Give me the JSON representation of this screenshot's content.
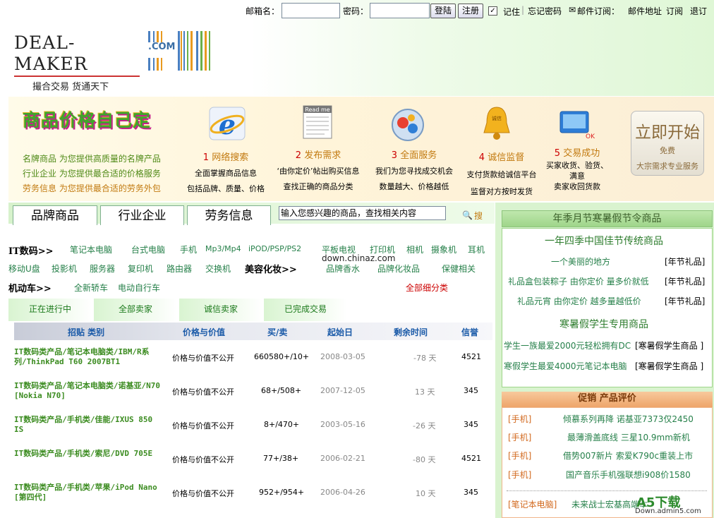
{
  "login": {
    "email_label": "邮箱名：",
    "password_label": "密码：",
    "login_btn": "登陆",
    "register_btn": "注册",
    "remember": "记住",
    "forgot": "忘记密码",
    "subscribe": "邮件订阅：",
    "mail_addr": "邮件地址",
    "sub": "订阅",
    "unsub": "退订"
  },
  "logo": {
    "name": "DEAL-MAKER",
    "slogan": "撮合交易 货通天下",
    "com": ".COM"
  },
  "band": {
    "slogan": "商品价格自己定",
    "lines": [
      {
        "a": "名牌商品",
        "b": "为您提供高质量的名牌产品"
      },
      {
        "a": "行业企业",
        "b": "为您提供最合适的价格服务"
      },
      {
        "a": "劳务信息",
        "b": "为您提供最合适的劳务外包"
      }
    ],
    "steps": [
      {
        "num": "1",
        "title": "网络搜索",
        "l1": "全面掌握商品信息",
        "l2": "包括品牌、质量、价格"
      },
      {
        "num": "2",
        "title": "发布需求",
        "l1": "‘由你定价’帖出购买信息",
        "l2": "查找正确的商品分类"
      },
      {
        "num": "3",
        "title": "全面服务",
        "l1": "我们为您寻找成交机会",
        "l2": "数量越大、价格越低"
      },
      {
        "num": "4",
        "title": "诚信监督",
        "l1": "支付货款给诚信平台",
        "l2": "监督对方按时发货"
      },
      {
        "num": "5",
        "title": "交易成功",
        "l1": "买家收货、验货、",
        "l2": "满意",
        "l3": "卖家收回货款"
      }
    ],
    "start_title": "立即开始",
    "start_sub": "免费",
    "start_note": "大宗需求专业服务"
  },
  "tabs": [
    "品牌商品",
    "行业企业",
    "劳务信息"
  ],
  "search": {
    "value": "输入您感兴趣的商品，查找相关内容",
    "btn": "搜"
  },
  "cats": {
    "it": "IT数码>>",
    "it_items": [
      "笔记本电脑",
      "台式电脑",
      "手机",
      "Mp3/Mp4",
      "iPOD/PSP/PS2",
      "平板电视",
      "打印机",
      "相机",
      "摄象机",
      "耳机",
      "移动U盘",
      "投影机",
      "服务器",
      "复印机",
      "路由器",
      "交换机"
    ],
    "beauty": "美容化妆>>",
    "beauty_items": [
      "品牌香水",
      "品牌化妆品",
      "保健相关"
    ],
    "car": "机动车>>",
    "car_items": [
      "全新轿车",
      "电动自行车"
    ],
    "all": "全部细分类",
    "watermark": "down.chinaz.com"
  },
  "status_tabs": [
    "正在进行中",
    "全部卖家",
    "诚信卖家",
    "已完成交易"
  ],
  "table": {
    "headers": [
      "招贴 类别",
      "价格与价值",
      "买/卖",
      "起始日",
      "剩余时间",
      "信誉"
    ],
    "rows": [
      {
        "title": "IT数码类产品/笔记本电脑类/IBM/R系列/ThinkPad T60 2007BT1",
        "price": "价格与价值不公开",
        "bs": "660580+/10+",
        "date": "2008-03-05",
        "left": "-78 天",
        "credit": "4521"
      },
      {
        "title": "IT数码类产品/笔记本电脑类/诺基亚/N70 [Nokia N70]",
        "price": "价格与价值不公开",
        "bs": "68+/508+",
        "date": "2007-12-05",
        "left": "13 天",
        "credit": "345"
      },
      {
        "title": "IT数码类产品/手机类/佳能/IXUS 850 IS",
        "price": "价格与价值不公开",
        "bs": "8+/470+",
        "date": "2003-05-16",
        "left": "-26 天",
        "credit": "345"
      },
      {
        "title": "IT数码类产品/手机类/索尼/DVD 705E",
        "price": "价格与价值不公开",
        "bs": "77+/38+",
        "date": "2006-02-21",
        "left": "-80 天",
        "credit": "4521"
      },
      {
        "title": "IT数码类产品/手机类/苹果/iPod Nano [第四代]",
        "price": "价格与价值不公开",
        "bs": "952+/954+",
        "date": "2006-04-26",
        "left": "10 天",
        "credit": "345"
      }
    ]
  },
  "right": {
    "header": "年季月节寒暑假节令商品",
    "sec1": "一年四季中国佳节传统商品",
    "sec1_items": [
      {
        "t": "一个美丽的地方",
        "tag": "[年节礼品]"
      },
      {
        "t": "礼品盒包装粽子 由你定价 量多价就低",
        "tag": "[年节礼品]"
      },
      {
        "t": "礼品元宵 由你定价 越多量越低价",
        "tag": "[年节礼品]"
      }
    ],
    "sec2": "寒暑假学生专用商品",
    "sec2_items": [
      {
        "t": "学生一族最爱2000元轻松拥有DC",
        "tag": "[寒暑假学生商品 ]"
      },
      {
        "t": "寒假学生最爱4000元笔记本电脑",
        "tag": "[寒暑假学生商品 ]"
      }
    ],
    "promo": "促销 产品评价",
    "promo_items": [
      {
        "tag": "[手机]",
        "t": "倾慕系列再降 诺基亚7373仅2450"
      },
      {
        "tag": "[手机]",
        "t": "最薄滑盖底线 三星10.9mm新机"
      },
      {
        "tag": "[手机]",
        "t": "借势007新片 索爱K790c重装上市"
      },
      {
        "tag": "[手机]",
        "t": "国产音乐手机强联想i908价1580"
      },
      {
        "tag": "[笔记本电脑]",
        "t": "未来战士宏基高端本"
      }
    ],
    "a5": "A5下载",
    "a5_url": "Down.admin5.com"
  },
  "colors": {
    "green": "#4f8a17",
    "orange": "#c27a10",
    "red": "#cc0000"
  }
}
